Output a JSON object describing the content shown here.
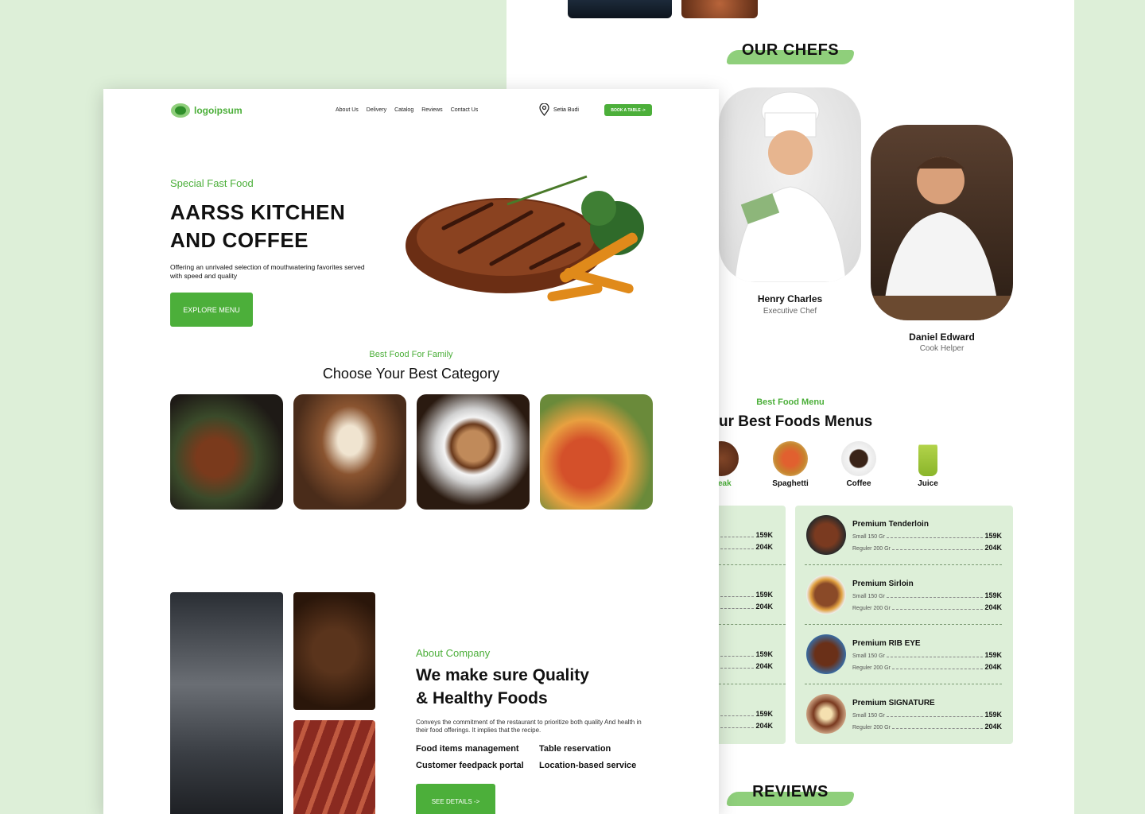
{
  "colors": {
    "accent": "#4caf3a",
    "accent_light": "#8fcf7b",
    "background": "#ddefd8"
  },
  "header": {
    "logo_text": "logoipsum",
    "nav": [
      "About Us",
      "Delivery",
      "Catalog",
      "Reviews",
      "Contact Us"
    ],
    "location_icon": "map-pin-icon",
    "location": "Setia Budi",
    "book_button": "BOOK A TABLE ->"
  },
  "hero": {
    "eyebrow": "Special Fast Food",
    "title_line1": "AARSS KITCHEN",
    "title_line2": "AND COFFEE",
    "description": "Offering an unrivaled selection of mouthwatering favorites served with speed and quality",
    "cta": "EXPLORE MENU"
  },
  "category": {
    "eyebrow": "Best Food For Family",
    "title": "Choose Your Best Category"
  },
  "about": {
    "eyebrow": "About Company",
    "title_line1": "We make sure Quality",
    "title_line2": "& Healthy Foods",
    "description": "Conveys the commitment of the restaurant to prioritize both quality And health in their food offerings. It implies that the recipe.",
    "features": [
      "Food items management",
      "Table reservation",
      "Customer feedpack portal",
      "Location-based service"
    ],
    "cta": "SEE DETAILS ->"
  },
  "chefs": {
    "heading": "OUR CHEFS",
    "list": [
      {
        "name": "Henry Charles",
        "role": "Executive Chef"
      },
      {
        "name": "Daniel Edward",
        "role": "Cook Helper"
      }
    ]
  },
  "menu": {
    "eyebrow": "Best Food Menu",
    "title": "ur Best Foods Menus",
    "categories": [
      "eak",
      "Spaghetti",
      "Coffee",
      "Juice"
    ],
    "items": [
      {
        "name": "Premium Tenderloin",
        "small": "Small 150 Gr",
        "regular": "Reguler 200 Gr",
        "price_small": "159K",
        "price_regular": "204K"
      },
      {
        "name": "Premium Sirloin",
        "small": "Small 150 Gr",
        "regular": "Reguler 200 Gr",
        "price_small": "159K",
        "price_regular": "204K"
      },
      {
        "name": "Premium RIB EYE",
        "small": "Small 150 Gr",
        "regular": "Reguler 200 Gr",
        "price_small": "159K",
        "price_regular": "204K"
      },
      {
        "name": "Premium SIGNATURE",
        "small": "Small 150 Gr",
        "regular": "Reguler 200 Gr",
        "price_small": "159K",
        "price_regular": "204K"
      }
    ],
    "left_prices": [
      {
        "small": "159K",
        "regular": "204K"
      },
      {
        "small": "159K",
        "regular": "204K"
      },
      {
        "small": "159K",
        "regular": "204K"
      },
      {
        "small": "159K",
        "regular": "204K"
      }
    ]
  },
  "reviews": {
    "heading": "REVIEWS"
  }
}
